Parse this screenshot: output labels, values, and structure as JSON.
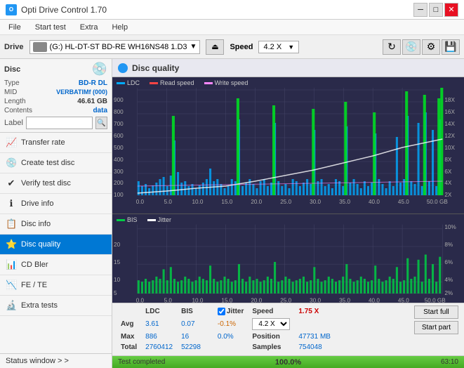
{
  "window": {
    "title": "Opti Drive Control 1.70",
    "icon": "O"
  },
  "menu": {
    "items": [
      "File",
      "Start test",
      "Extra",
      "Help"
    ]
  },
  "drive_bar": {
    "label": "Drive",
    "drive_name": "(G:)  HL-DT-ST BD-RE  WH16NS48 1.D3",
    "speed_label": "Speed",
    "speed_value": "4.2 X"
  },
  "disc_panel": {
    "type_label": "Type",
    "type_value": "BD-R DL",
    "mid_label": "MID",
    "mid_value": "VERBATIMf (000)",
    "length_label": "Length",
    "length_value": "46.61 GB",
    "contents_label": "Contents",
    "contents_value": "data",
    "label_label": "Label",
    "label_value": ""
  },
  "nav_items": [
    {
      "id": "transfer-rate",
      "label": "Transfer rate",
      "icon": "📈"
    },
    {
      "id": "create-test-disc",
      "label": "Create test disc",
      "icon": "💿"
    },
    {
      "id": "verify-test-disc",
      "label": "Verify test disc",
      "icon": "✔"
    },
    {
      "id": "drive-info",
      "label": "Drive info",
      "icon": "ℹ"
    },
    {
      "id": "disc-info",
      "label": "Disc info",
      "icon": "📋"
    },
    {
      "id": "disc-quality",
      "label": "Disc quality",
      "icon": "⭐",
      "active": true
    },
    {
      "id": "cd-bler",
      "label": "CD Bler",
      "icon": "📊"
    },
    {
      "id": "fe-te",
      "label": "FE / TE",
      "icon": "📉"
    },
    {
      "id": "extra-tests",
      "label": "Extra tests",
      "icon": "🔬"
    }
  ],
  "status_window": {
    "label": "Status window > >"
  },
  "disc_quality": {
    "title": "Disc quality"
  },
  "chart1": {
    "legend": [
      {
        "label": "LDC",
        "color": "#00aaff"
      },
      {
        "label": "Read speed",
        "color": "#ff4444"
      },
      {
        "label": "Write speed",
        "color": "#ff88ff"
      }
    ],
    "y_axis": [
      100,
      200,
      300,
      400,
      500,
      600,
      700,
      800,
      900
    ],
    "y_axis_right": [
      "2X",
      "4X",
      "6X",
      "8X",
      "10X",
      "12X",
      "14X",
      "16X",
      "18X"
    ],
    "x_axis": [
      "0.0",
      "5.0",
      "10.0",
      "15.0",
      "20.0",
      "25.0",
      "30.0",
      "35.0",
      "40.0",
      "45.0",
      "50.0 GB"
    ]
  },
  "chart2": {
    "legend": [
      {
        "label": "BIS",
        "color": "#00cc44"
      },
      {
        "label": "Jitter",
        "color": "#ffffff"
      }
    ],
    "y_axis": [
      5,
      10,
      15,
      20
    ],
    "y_axis_right": [
      "2%",
      "4%",
      "6%",
      "8%",
      "10%"
    ],
    "x_axis": [
      "0.0",
      "5.0",
      "10.0",
      "15.0",
      "20.0",
      "25.0",
      "30.0",
      "35.0",
      "40.0",
      "45.0",
      "50.0 GB"
    ]
  },
  "stats": {
    "columns": [
      "",
      "LDC",
      "BIS",
      "",
      "Jitter",
      "Speed",
      ""
    ],
    "avg_label": "Avg",
    "avg_ldc": "3.61",
    "avg_bis": "0.07",
    "avg_jitter": "-0.1%",
    "max_label": "Max",
    "max_ldc": "886",
    "max_bis": "16",
    "max_jitter": "0.0%",
    "total_label": "Total",
    "total_ldc": "2760412",
    "total_bis": "52298",
    "speed_label": "Speed",
    "speed_value": "1.75 X",
    "speed_dropdown": "4.2 X",
    "position_label": "Position",
    "position_value": "47731 MB",
    "samples_label": "Samples",
    "samples_value": "754048",
    "jitter_checked": true,
    "start_full_label": "Start full",
    "start_part_label": "Start part"
  },
  "progress": {
    "status": "Test completed",
    "percent": "100.0%",
    "fill_width": 100,
    "right_value": "63:10"
  }
}
